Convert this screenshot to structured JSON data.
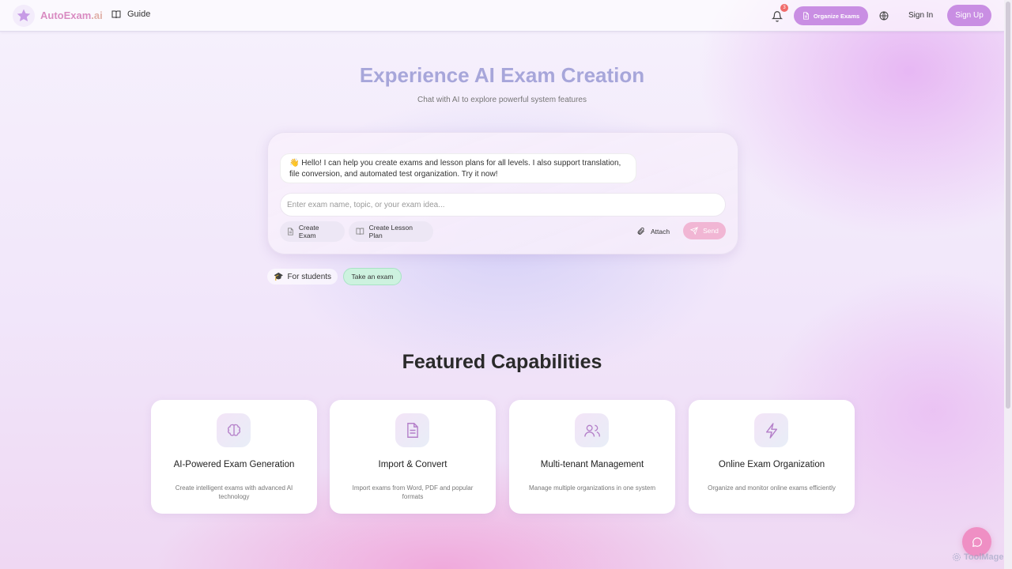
{
  "header": {
    "brand_name": "AutoExam",
    "brand_tld": ".ai",
    "guide_label": "Guide",
    "notification_count": "3",
    "organize_label": "Organize Exams",
    "signin_label": "Sign In",
    "signup_label": "Sign Up"
  },
  "hero": {
    "title": "Experience AI Exam Creation",
    "subtitle": "Chat with AI to explore powerful system features"
  },
  "chat": {
    "greeting": "👋 Hello! I can help you create exams and lesson plans for all levels. I also support translation, file conversion, and automated test organization. Try it now!",
    "input_placeholder": "Enter exam name, topic, or your exam idea...",
    "input_value": "",
    "create_exam_label": "Create Exam",
    "create_lesson_label": "Create Lesson Plan",
    "attach_label": "Attach",
    "send_label": "Send"
  },
  "students": {
    "for_students_label": "For students",
    "take_exam_label": "Take an exam"
  },
  "features": {
    "title": "Featured Capabilities",
    "items": [
      {
        "icon": "brain-icon",
        "title": "AI-Powered Exam Generation",
        "desc": "Create intelligent exams with advanced AI technology"
      },
      {
        "icon": "document-icon",
        "title": "Import & Convert",
        "desc": "Import exams from Word, PDF and popular formats"
      },
      {
        "icon": "users-icon",
        "title": "Multi-tenant Management",
        "desc": "Manage multiple organizations in one system"
      },
      {
        "icon": "lightning-icon",
        "title": "Online Exam Organization",
        "desc": "Organize and monitor online exams efficiently"
      }
    ]
  },
  "watermark": "ToolMage",
  "colors": {
    "accent": "#c98ee3",
    "send": "#f1b6d4",
    "take_exam": "#cdf2df",
    "fab": "#ef8fc4",
    "badge": "#f06b6b"
  }
}
